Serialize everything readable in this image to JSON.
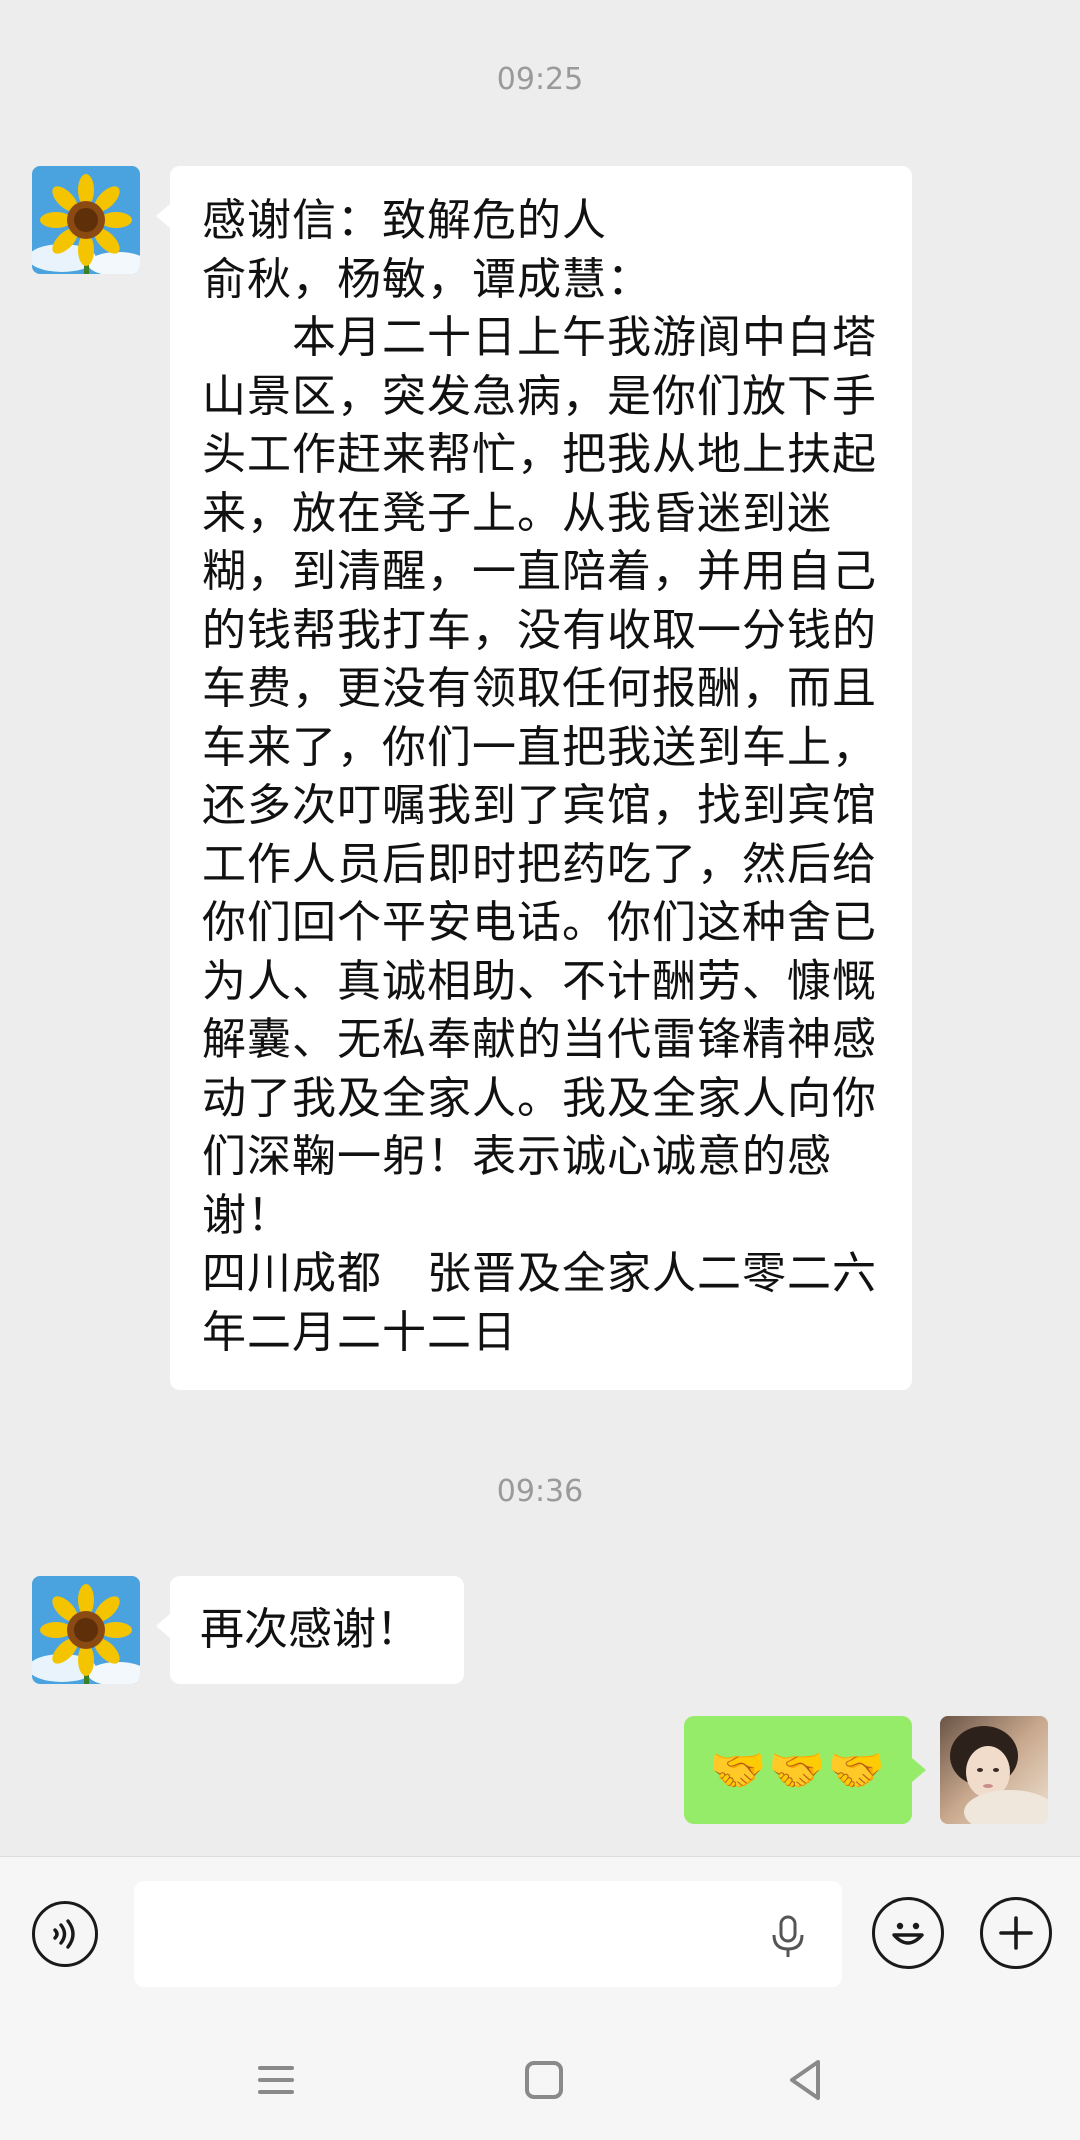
{
  "messages": [
    {
      "time": "09:25",
      "sender": "contact",
      "avatar": "sunflower-avatar",
      "text": "感谢信：致解危的人\n俞秋，杨敏，谭成慧：\n　　本月二十日上午我游阆中白塔山景区，突发急病，是你们放下手头工作赶来帮忙，把我从地上扶起来，放在凳子上。从我昏迷到迷糊，到清醒，一直陪着，并用自己的钱帮我打车，没有收取一分钱的车费，更没有领取任何报酬，而且车来了，你们一直把我送到车上，还多次叮嘱我到了宾馆，找到宾馆工作人员后即时把药吃了，然后给你们回个平安电话。你们这种舍已为人、真诚相助、不计酬劳、慷慨解囊、无私奉献的当代雷锋精神感动了我及全家人。我及全家人向你们深鞠一躬！表示诚心诚意的感谢！\n四川成都　张晋及全家人二零二六年二月二十二日"
    },
    {
      "time": "09:36",
      "sender": "contact",
      "avatar": "sunflower-avatar",
      "text": "再次感谢！"
    },
    {
      "sender": "self",
      "avatar": "user-photo-avatar",
      "text": "🤝🤝🤝"
    }
  ],
  "input_bar": {
    "left_icon": "voice-mode-icon",
    "field_icon": "microphone-icon",
    "right_icons": [
      "emoji-icon",
      "plus-icon"
    ]
  },
  "nav_bar": {
    "icons": [
      "menu-icon",
      "home-icon",
      "back-icon"
    ]
  },
  "colors": {
    "background": "#ededed",
    "incoming_bubble": "#ffffff",
    "outgoing_bubble": "#95ec69",
    "timestamp": "#9a9a9a"
  }
}
